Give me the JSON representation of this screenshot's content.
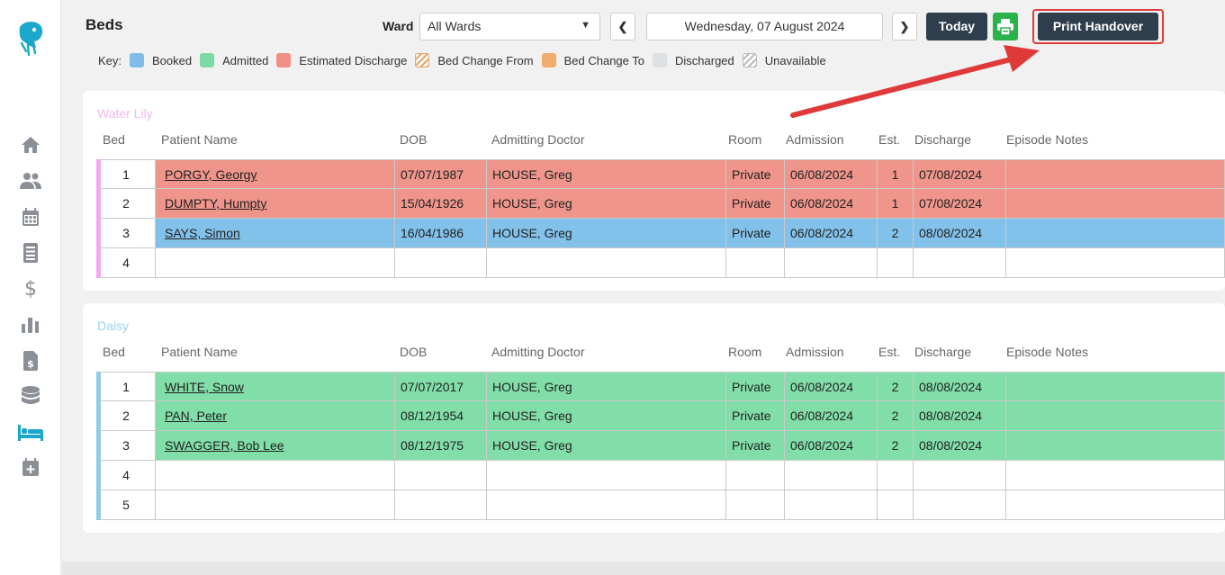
{
  "header": {
    "title": "Beds",
    "ward_label": "Ward",
    "ward_value": "All Wards",
    "date": "Wednesday, 07 August 2024",
    "today_label": "Today",
    "print_handover_label": "Print Handover"
  },
  "key": {
    "label": "Key:",
    "items": [
      {
        "label": "Booked",
        "color": "#7fbde8"
      },
      {
        "label": "Admitted",
        "color": "#7ddaa4"
      },
      {
        "label": "Estimated Discharge",
        "color": "#ef8f85"
      },
      {
        "label": "Bed Change From",
        "color": "#e8a46b"
      },
      {
        "label": "Bed Change To",
        "color": "#f0ad6e"
      },
      {
        "label": "Discharged",
        "color": "#dde1e5"
      },
      {
        "label": "Unavailable",
        "color": "#bbbbbb"
      }
    ]
  },
  "columns": [
    "Bed",
    "Patient Name",
    "DOB",
    "Admitting Doctor",
    "Room",
    "Admission",
    "Est.",
    "Discharge",
    "Episode Notes"
  ],
  "wards": [
    {
      "name": "Water Lily",
      "name_color": "#f3b6f0",
      "bar_color": "#f3a8f0",
      "rows": [
        {
          "bed": "1",
          "name": "PORGY, Georgy",
          "dob": "07/07/1987",
          "doctor": "HOUSE, Greg",
          "room": "Private",
          "admission": "06/08/2024",
          "est": "1",
          "discharge": "07/08/2024",
          "notes": "",
          "status_color": "#ef958b"
        },
        {
          "bed": "2",
          "name": "DUMPTY, Humpty",
          "dob": "15/04/1926",
          "doctor": "HOUSE, Greg",
          "room": "Private",
          "admission": "06/08/2024",
          "est": "1",
          "discharge": "07/08/2024",
          "notes": "",
          "status_color": "#ef958b"
        },
        {
          "bed": "3",
          "name": "SAYS, Simon",
          "dob": "16/04/1986",
          "doctor": "HOUSE, Greg",
          "room": "Private",
          "admission": "06/08/2024",
          "est": "2",
          "discharge": "08/08/2024",
          "notes": "",
          "status_color": "#82c1ea"
        },
        {
          "bed": "4",
          "name": "",
          "dob": "",
          "doctor": "",
          "room": "",
          "admission": "",
          "est": "",
          "discharge": "",
          "notes": "",
          "status_color": "#ffffff"
        }
      ]
    },
    {
      "name": "Daisy",
      "name_color": "#9fd4ee",
      "bar_color": "#8fcbe8",
      "rows": [
        {
          "bed": "1",
          "name": "WHITE, Snow",
          "dob": "07/07/2017",
          "doctor": "HOUSE, Greg",
          "room": "Private",
          "admission": "06/08/2024",
          "est": "2",
          "discharge": "08/08/2024",
          "notes": "",
          "status_color": "#81dea8"
        },
        {
          "bed": "2",
          "name": "PAN, Peter",
          "dob": "08/12/1954",
          "doctor": "HOUSE, Greg",
          "room": "Private",
          "admission": "06/08/2024",
          "est": "2",
          "discharge": "08/08/2024",
          "notes": "",
          "status_color": "#81dea8"
        },
        {
          "bed": "3",
          "name": "SWAGGER, Bob Lee",
          "dob": "08/12/1975",
          "doctor": "HOUSE, Greg",
          "room": "Private",
          "admission": "06/08/2024",
          "est": "2",
          "discharge": "08/08/2024",
          "notes": "",
          "status_color": "#81dea8"
        },
        {
          "bed": "4",
          "name": "",
          "dob": "",
          "doctor": "",
          "room": "",
          "admission": "",
          "est": "",
          "discharge": "",
          "notes": "",
          "status_color": "#ffffff"
        },
        {
          "bed": "5",
          "name": "",
          "dob": "",
          "doctor": "",
          "room": "",
          "admission": "",
          "est": "",
          "discharge": "",
          "notes": "",
          "status_color": "#ffffff"
        }
      ]
    }
  ],
  "sidebar": {
    "icon_color": "#8a9096",
    "active_color": "#1aa7c9",
    "items": [
      {
        "icon": "home-icon"
      },
      {
        "icon": "patients-icon"
      },
      {
        "icon": "calendar-icon"
      },
      {
        "icon": "list-icon"
      },
      {
        "icon": "dollar-icon"
      },
      {
        "icon": "bar-chart-icon"
      },
      {
        "icon": "invoice-icon"
      },
      {
        "icon": "database-icon"
      },
      {
        "icon": "bed-icon",
        "active": true
      },
      {
        "icon": "calendar-plus-icon"
      }
    ]
  },
  "annotation": {
    "arrow_color": "#e0393a",
    "highlight_color": "#e03a3a"
  }
}
